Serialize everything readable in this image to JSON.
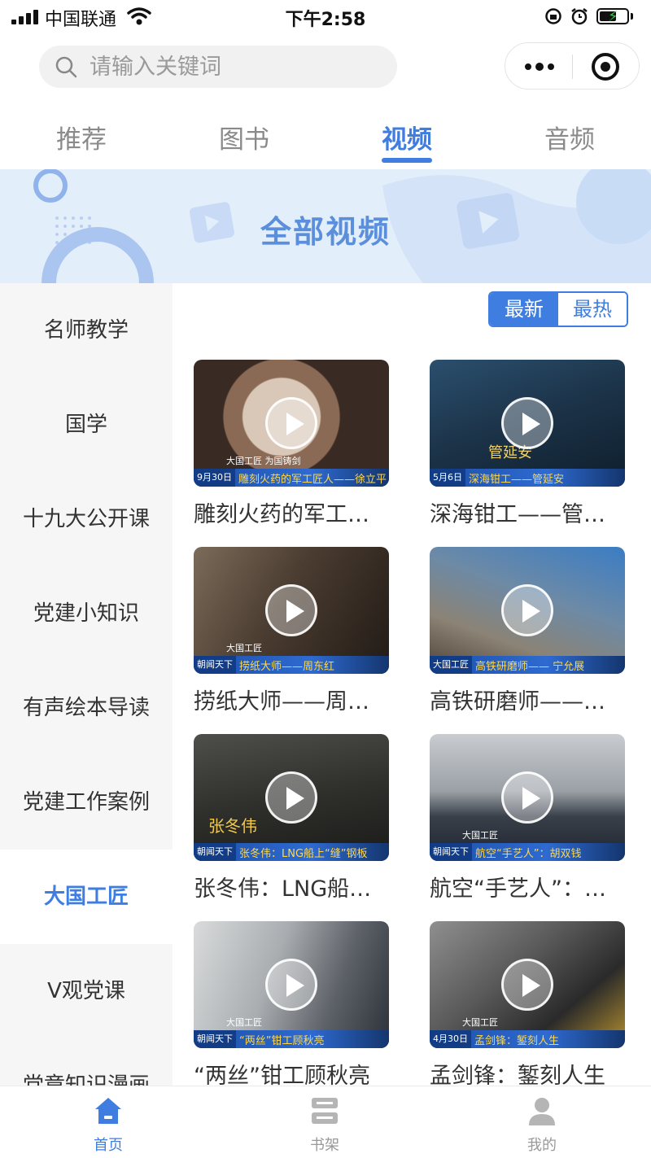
{
  "status_bar": {
    "carrier": "中国联通",
    "time": "下午2:58"
  },
  "search": {
    "placeholder": "请输入关键词"
  },
  "top_tabs": [
    {
      "label": "推荐",
      "active": false
    },
    {
      "label": "图书",
      "active": false
    },
    {
      "label": "视频",
      "active": true
    },
    {
      "label": "音频",
      "active": false
    }
  ],
  "banner": {
    "title": "全部视频"
  },
  "sidebar": {
    "items": [
      {
        "label": "名师教学"
      },
      {
        "label": "国学"
      },
      {
        "label": "十九大公开课"
      },
      {
        "label": "党建小知识"
      },
      {
        "label": "有声绘本导读"
      },
      {
        "label": "党建工作案例"
      },
      {
        "label": "大国工匠"
      },
      {
        "label": "V观党课"
      },
      {
        "label": "党章知识漫画"
      }
    ],
    "active_label": "大国工匠"
  },
  "sort": {
    "newest": "最新",
    "hottest": "最热"
  },
  "videos": [
    {
      "title": "雕刻火药的军工…",
      "caption": "雕刻火药的军工匠人——徐立平",
      "tag": "9月30日",
      "brand": "大国工匠 为国铸剑"
    },
    {
      "title": "深海钳工——管…",
      "caption": "深海钳工——管延安",
      "tag": "5月6日",
      "brand": "管延安"
    },
    {
      "title": "捞纸大师——周…",
      "caption": "捞纸大师——周东红",
      "tag": "朝闻天下",
      "brand": "大国工匠"
    },
    {
      "title": "高铁研磨师——…",
      "caption": "高铁研磨师—— 宁允展",
      "tag": "大国工匠",
      "brand": ""
    },
    {
      "title": "张冬伟：LNG船…",
      "caption": "张冬伟：LNG船上“缝”钢板",
      "tag": "朝闻天下",
      "brand": "张冬伟"
    },
    {
      "title": "航空“手艺人”：…",
      "caption": "航空“手艺人”：胡双钱",
      "tag": "朝闻天下",
      "brand": "大国工匠"
    },
    {
      "title": "“两丝”钳工顾秋亮",
      "caption": "“两丝”钳工顾秋亮",
      "tag": "朝闻天下",
      "brand": "大国工匠"
    },
    {
      "title": "孟剑锋：錾刻人生",
      "caption": "孟剑锋：錾刻人生",
      "tag": "4月30日",
      "brand": "大国工匠"
    }
  ],
  "bottom_nav": [
    {
      "label": "首页",
      "icon": "home-icon",
      "active": true
    },
    {
      "label": "书架",
      "icon": "bookshelf-icon",
      "active": false
    },
    {
      "label": "我的",
      "icon": "profile-icon",
      "active": false
    }
  ],
  "colors": {
    "accent": "#3f7ee0",
    "banner_bg": "#e3eefb",
    "sidebar_bg": "#f6f6f6"
  }
}
